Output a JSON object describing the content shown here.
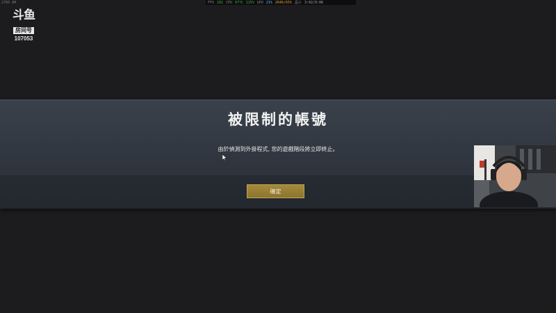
{
  "overlay": {
    "corner_text": "2760 AM",
    "perf": [
      {
        "label": "FPS",
        "value": "202"
      },
      {
        "label": "CPU",
        "value": "67℃"
      },
      {
        "label": "",
        "value": "115%"
      },
      {
        "label": "GPU",
        "value": "21%"
      },
      {
        "label": "",
        "value": "2646/65%"
      },
      {
        "label": "品小",
        "value": "3:02/9:06"
      }
    ]
  },
  "watermark": {
    "logo_text": "斗鱼",
    "tag": "房间号",
    "room_number": "107053"
  },
  "dialog": {
    "title": "被限制的帳號",
    "message": "由於偵測到外掛程式, 您的遊戲階段將立即終止。",
    "confirm_label": "確定"
  },
  "colors": {
    "background": "#1c1c1e",
    "band": "#343a43",
    "button_gold": "#9a8135"
  }
}
